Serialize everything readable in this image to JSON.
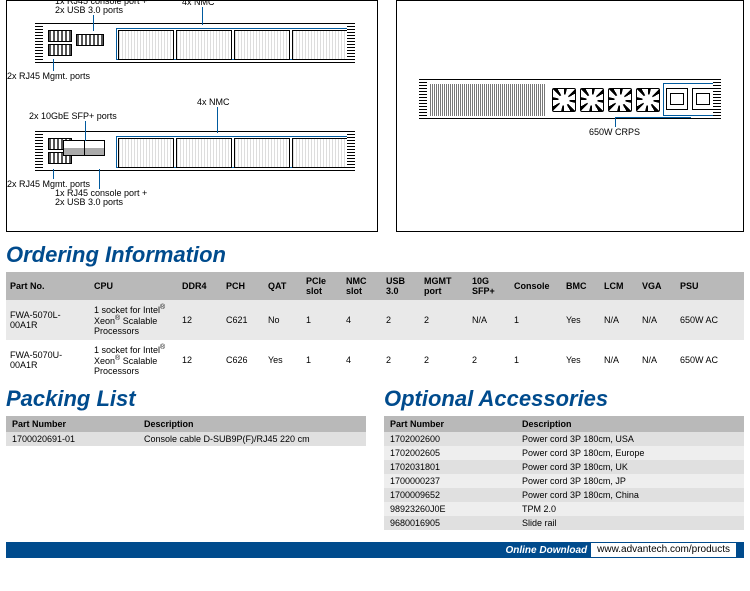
{
  "diagram_left": {
    "nmc_4x": "4x NMC",
    "console_usb": "1x RJ45 console port +\n2x USB 3.0 ports",
    "mgmt_2x": "2x RJ45 Mgmt. ports",
    "sfp_2x": "2x 10GbE SFP+ ports"
  },
  "diagram_right": {
    "psu": "650W CRPS"
  },
  "ordering": {
    "title": "Ordering Information",
    "headers": [
      "Part No.",
      "CPU",
      "DDR4",
      "PCH",
      "QAT",
      "PCIe slot",
      "NMC slot",
      "USB 3.0",
      "MGMT port",
      "10G SFP+",
      "Console",
      "BMC",
      "LCM",
      "VGA",
      "PSU"
    ],
    "rows": [
      {
        "part": "FWA-5070L-00A1R",
        "cpu": "1 socket for Intel® Xeon® Scalable Processors",
        "ddr4": "12",
        "pch": "C621",
        "qat": "No",
        "pcie": "1",
        "nmc": "4",
        "usb": "2",
        "mgmt": "2",
        "sfp": "N/A",
        "console": "1",
        "bmc": "Yes",
        "lcm": "N/A",
        "vga": "N/A",
        "psu": "650W AC"
      },
      {
        "part": "FWA-5070U-00A1R",
        "cpu": "1 socket for Intel® Xeon® Scalable Processors",
        "ddr4": "12",
        "pch": "C626",
        "qat": "Yes",
        "pcie": "1",
        "nmc": "4",
        "usb": "2",
        "mgmt": "2",
        "sfp": "2",
        "console": "1",
        "bmc": "Yes",
        "lcm": "N/A",
        "vga": "N/A",
        "psu": "650W AC"
      }
    ]
  },
  "packing": {
    "title": "Packing List",
    "headers": [
      "Part Number",
      "Description"
    ],
    "rows": [
      {
        "pn": "1700020691-01",
        "desc": "Console cable D-SUB9P(F)/RJ45 220 cm"
      }
    ]
  },
  "accessories": {
    "title": "Optional Accessories",
    "headers": [
      "Part Number",
      "Description"
    ],
    "rows": [
      {
        "pn": "1702002600",
        "desc": "Power cord 3P 180cm, USA"
      },
      {
        "pn": "1702002605",
        "desc": "Power cord 3P 180cm, Europe"
      },
      {
        "pn": "1702031801",
        "desc": "Power cord 3P 180cm, UK"
      },
      {
        "pn": "1700000237",
        "desc": "Power cord 3P 180cm, JP"
      },
      {
        "pn": "1700009652",
        "desc": "Power cord 3P 180cm, China"
      },
      {
        "pn": "98923260J0E",
        "desc": "TPM 2.0"
      },
      {
        "pn": "9680016905",
        "desc": "Slide rail"
      }
    ]
  },
  "footer": {
    "label": "Online Download",
    "url": "www.advantech.com/products"
  }
}
